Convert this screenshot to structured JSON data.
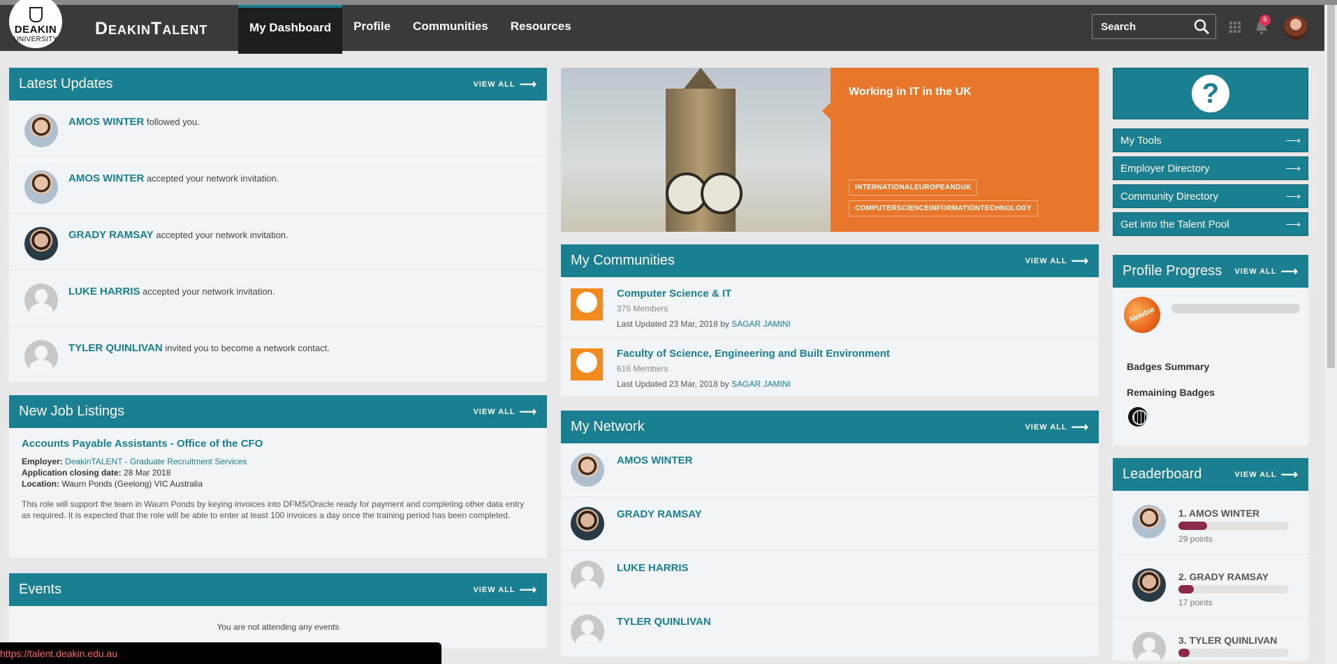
{
  "header": {
    "logo_line1": "DEAKIN",
    "logo_line2": "UNIVERSITY",
    "brand": "DeakinTalent",
    "nav": [
      {
        "label": "My Dashboard",
        "active": true
      },
      {
        "label": "Profile"
      },
      {
        "label": "Communities"
      },
      {
        "label": "Resources"
      }
    ],
    "search_placeholder": "Search",
    "notification_count": "8"
  },
  "latest_updates": {
    "title": "Latest Updates",
    "view_all": "VIEW ALL",
    "items": [
      {
        "name": "AMOS WINTER",
        "text": "followed you."
      },
      {
        "name": "AMOS WINTER",
        "text": "accepted your network invitation."
      },
      {
        "name": "GRADY RAMSAY",
        "text": "accepted your network invitation."
      },
      {
        "name": "LUKE HARRIS",
        "text": "accepted your network invitation."
      },
      {
        "name": "TYLER QUINLIVAN",
        "text": "invited you to become a network contact."
      }
    ]
  },
  "jobs": {
    "title": "New Job Listings",
    "view_all": "VIEW ALL",
    "job_title": "Accounts Payable Assistants - Office of the CFO",
    "employer_label": "Employer:",
    "employer": "DeakinTALENT - Graduate Recruitment Services",
    "closing_label": "Application closing date:",
    "closing": "28 Mar 2018",
    "location_label": "Location:",
    "location": "Waurn Ponds (Geelong) VIC Australia",
    "description": "This role will support the team in Waurn Ponds by keying invoices into DFMS/Oracle ready for payment and completing other data entry as required. It is expected that the role will be able to enter at least 100 invoices a day once the training period has been completed."
  },
  "events": {
    "title": "Events",
    "view_all": "VIEW ALL",
    "empty": "You are not attending any events"
  },
  "hero": {
    "title": "Working in IT in the UK",
    "tags": [
      "INTERNATIONALEUROPEANDUK",
      "COMPUTERSCIENCEINFORMATIONTECHNOLOGY"
    ]
  },
  "communities": {
    "title": "My Communities",
    "view_all": "VIEW ALL",
    "items": [
      {
        "name": "Computer Science & IT",
        "members": "375 Members",
        "updated": "Last Updated 23 Mar, 2018 by",
        "by": "SAGAR JAMINI"
      },
      {
        "name": "Faculty of Science, Engineering and Built Environment",
        "members": "616 Members",
        "updated": "Last Updated 23 Mar, 2018 by",
        "by": "SAGAR JAMINI"
      }
    ]
  },
  "network": {
    "title": "My Network",
    "view_all": "VIEW ALL",
    "items": [
      "AMOS WINTER",
      "GRADY RAMSAY",
      "LUKE HARRIS",
      "TYLER QUINLIVAN"
    ]
  },
  "quicklinks": [
    "My Tools",
    "Employer Directory",
    "Community Directory",
    "Get into the Talent Pool"
  ],
  "profile_progress": {
    "title": "Profile Progress",
    "view_all": "VIEW ALL",
    "badge_text": "Newbie",
    "progress_fraction": 0.0,
    "badges_summary": "Badges Summary",
    "remaining_badges": "Remaining Badges"
  },
  "leaderboard": {
    "title": "Leaderboard",
    "view_all": "VIEW ALL",
    "items": [
      {
        "rank": "1. AMOS WINTER",
        "points": "29 points",
        "fraction": 0.26
      },
      {
        "rank": "2. GRADY RAMSAY",
        "points": "17 points",
        "fraction": 0.14
      },
      {
        "rank": "3. TYLER QUINLIVAN",
        "points": "",
        "fraction": 0.1
      }
    ]
  },
  "status_url": "https://talent.deakin.edu.au",
  "colors": {
    "accent": "#1a7f91",
    "orange": "#e8772b",
    "leader_bar": "#8b2a4a"
  }
}
